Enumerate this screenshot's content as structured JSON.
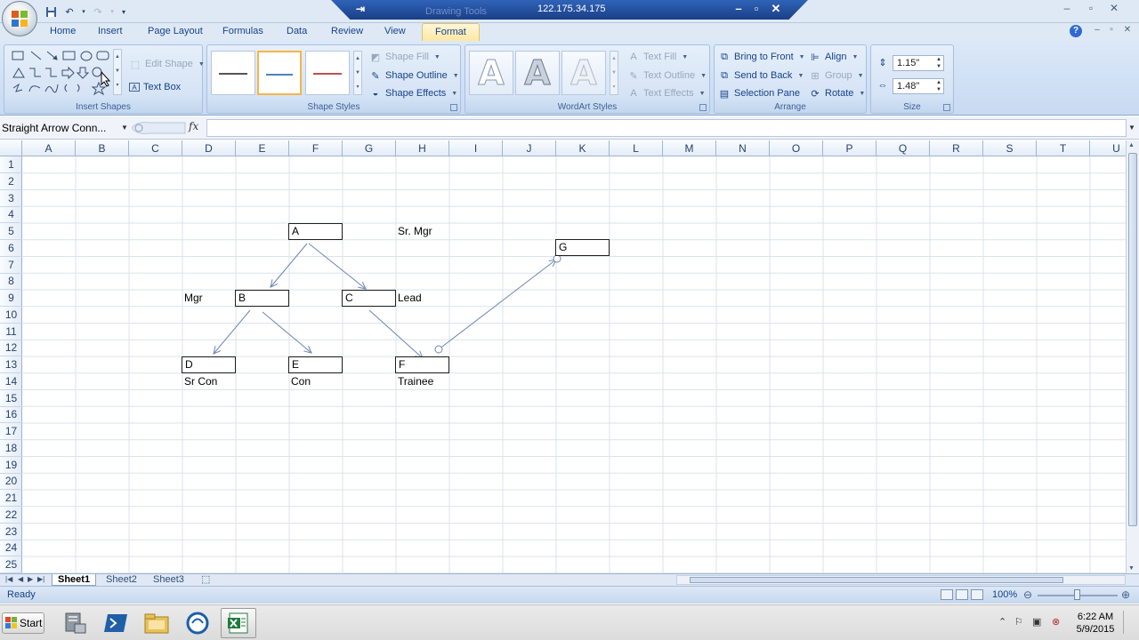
{
  "window": {
    "remote_ip": "122.175.34.175",
    "ghost_title": "Drawing Tools"
  },
  "tabs": [
    "Home",
    "Insert",
    "Page Layout",
    "Formulas",
    "Data",
    "Review",
    "View",
    "Format"
  ],
  "active_tab": "Format",
  "ribbon": {
    "insert_shapes": {
      "label": "Insert Shapes",
      "edit_shape": "Edit Shape",
      "text_box": "Text Box"
    },
    "shape_styles": {
      "label": "Shape Styles",
      "fill": "Shape Fill",
      "outline": "Shape Outline",
      "effects": "Shape Effects",
      "swatch_colors": [
        "#555555",
        "#4f81bd",
        "#c0504d"
      ]
    },
    "wordart": {
      "label": "WordArt Styles",
      "letter": "A",
      "text_fill": "Text Fill",
      "text_outline": "Text Outline",
      "text_effects": "Text Effects"
    },
    "arrange": {
      "label": "Arrange",
      "bring_front": "Bring to Front",
      "send_back": "Send to Back",
      "selection_pane": "Selection Pane",
      "align": "Align",
      "group": "Group",
      "rotate": "Rotate"
    },
    "size": {
      "label": "Size",
      "height": "1.15\"",
      "width": "1.48\""
    }
  },
  "formula_bar": {
    "name_box": "Straight Arrow Conn...",
    "fx": "fx",
    "formula": ""
  },
  "columns": [
    "A",
    "B",
    "C",
    "D",
    "E",
    "F",
    "G",
    "H",
    "I",
    "J",
    "K",
    "L",
    "M",
    "N",
    "O",
    "P",
    "Q",
    "R",
    "S",
    "T",
    "U"
  ],
  "rows": [
    "1",
    "2",
    "3",
    "4",
    "5",
    "6",
    "7",
    "8",
    "9",
    "10",
    "11",
    "12",
    "13",
    "14",
    "15",
    "16",
    "17",
    "18",
    "19",
    "20",
    "21",
    "22",
    "23",
    "24",
    "25"
  ],
  "diagram": {
    "boxes": {
      "A": "A",
      "B": "B",
      "C": "C",
      "D": "D",
      "E": "E",
      "F": "F",
      "G": "G"
    },
    "labels": {
      "sr_mgr": "Sr. Mgr",
      "mgr": "Mgr",
      "lead": "Lead",
      "sr_con": "Sr Con",
      "con": "Con",
      "trainee": "Trainee"
    }
  },
  "sheets": [
    "Sheet1",
    "Sheet2",
    "Sheet3"
  ],
  "active_sheet": "Sheet1",
  "status": {
    "ready": "Ready",
    "zoom": "100%"
  },
  "taskbar": {
    "start": "Start",
    "time": "6:22 AM",
    "date": "5/9/2015"
  },
  "colors": {
    "ribbon_blue": "#c8daf2",
    "tab_active": "#ffe7a3",
    "rdp_bar": "#1b3f86",
    "excel_green": "#1f7a3a"
  }
}
